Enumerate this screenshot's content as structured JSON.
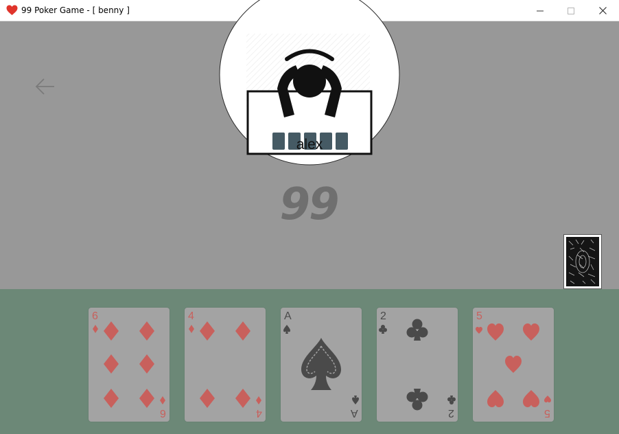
{
  "window": {
    "title": "99 Poker Game - [ benny ]",
    "icon": "heart-icon",
    "controls": [
      "minimize-icon",
      "maximize-icon",
      "close-icon"
    ]
  },
  "nav": {
    "back_icon": "arrow-left-icon"
  },
  "opponent": {
    "name": "alex",
    "hidden_cards": 5,
    "avatar_icon": "player-at-table-icon"
  },
  "score": {
    "value": "99"
  },
  "deck": {
    "icon": "card-back-icon"
  },
  "hand": [
    {
      "rank": "6",
      "suit": "diamonds",
      "color": "red"
    },
    {
      "rank": "4",
      "suit": "diamonds",
      "color": "red"
    },
    {
      "rank": "A",
      "suit": "spades",
      "color": "black"
    },
    {
      "rank": "2",
      "suit": "clubs",
      "color": "black"
    },
    {
      "rank": "5",
      "suit": "hearts",
      "color": "red"
    }
  ],
  "colors": {
    "table": "#989898",
    "hand_area": "#6c8877",
    "card_face": "#a3a3a3",
    "red_suit": "#c8605c",
    "black_suit": "#4a4a4a",
    "score": "#6f6f6f",
    "hidden_card": "#455a64"
  }
}
